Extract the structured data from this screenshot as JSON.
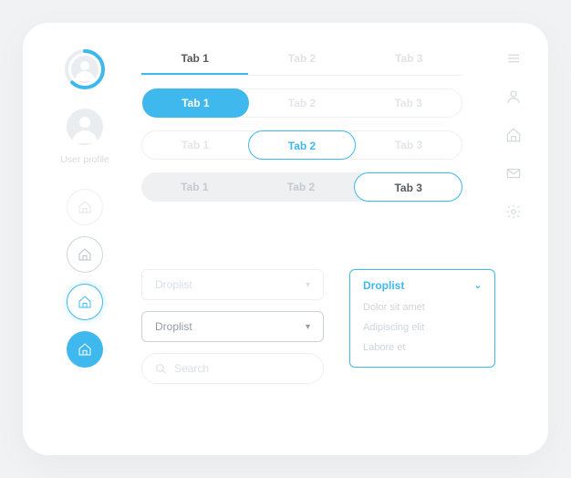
{
  "profile_label": "User profile",
  "tabs": {
    "underline": [
      "Tab 1",
      "Tab 2",
      "Tab 3"
    ],
    "pill1": [
      "Tab 1",
      "Tab 2",
      "Tab 3"
    ],
    "pill2": [
      "Tab 1",
      "Tab 2",
      "Tab 3"
    ],
    "pill3": [
      "Tab 1",
      "Tab 2",
      "Tab 3"
    ]
  },
  "droplists": {
    "light": "Droplist",
    "dark": "Droplist",
    "open_label": "Droplist",
    "options": [
      "Dolor sit amet",
      "Adipiscing elit",
      "Labore et"
    ]
  },
  "search_placeholder": "Search",
  "colors": {
    "accent": "#3fb8ee",
    "muted": "#dbe0e4"
  }
}
